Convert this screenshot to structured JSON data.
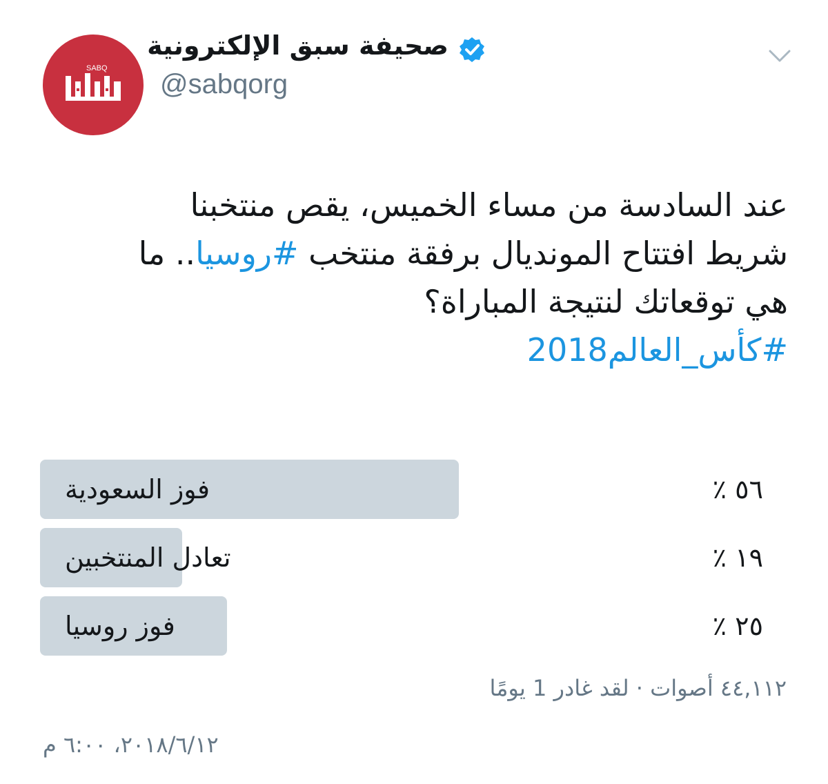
{
  "header": {
    "display_name": "صحيفة سبق الإلكترونية",
    "handle": "@sabqorg",
    "avatar_logo_text": "SABQ سبق",
    "verified_icon": "verified-badge-icon",
    "menu_icon": "chevron-down-icon"
  },
  "tweet": {
    "line1": "عند السادسة من مساء الخميس، يقص منتخبنا",
    "line2_before": "شريط افتتاح المونديال برفقة منتخب ",
    "line2_hashtag": "#روسيا",
    "line2_after": ".. ما",
    "line3": "هي توقعاتك لنتيجة المباراة؟",
    "line4_hashtag": "#كأس_العالم2018"
  },
  "poll": {
    "options": [
      {
        "label": "فوز السعودية",
        "percent_text": "٥٦ ٪",
        "percent": 56
      },
      {
        "label": "تعادل المنتخبين",
        "percent_text": "١٩ ٪",
        "percent": 19
      },
      {
        "label": "فوز روسيا",
        "percent_text": "٢٥ ٪",
        "percent": 25
      }
    ],
    "meta": "٤٤,١١٢ أصوات · لقد غادر 1 يومًا"
  },
  "timestamp": "٢٠١٨/٦/١٢، ٦:٠٠ م",
  "colors": {
    "accent": "#1b95e0",
    "avatar": "#c8303f",
    "bar": "#ccd6dd",
    "secondary_text": "#657786"
  }
}
